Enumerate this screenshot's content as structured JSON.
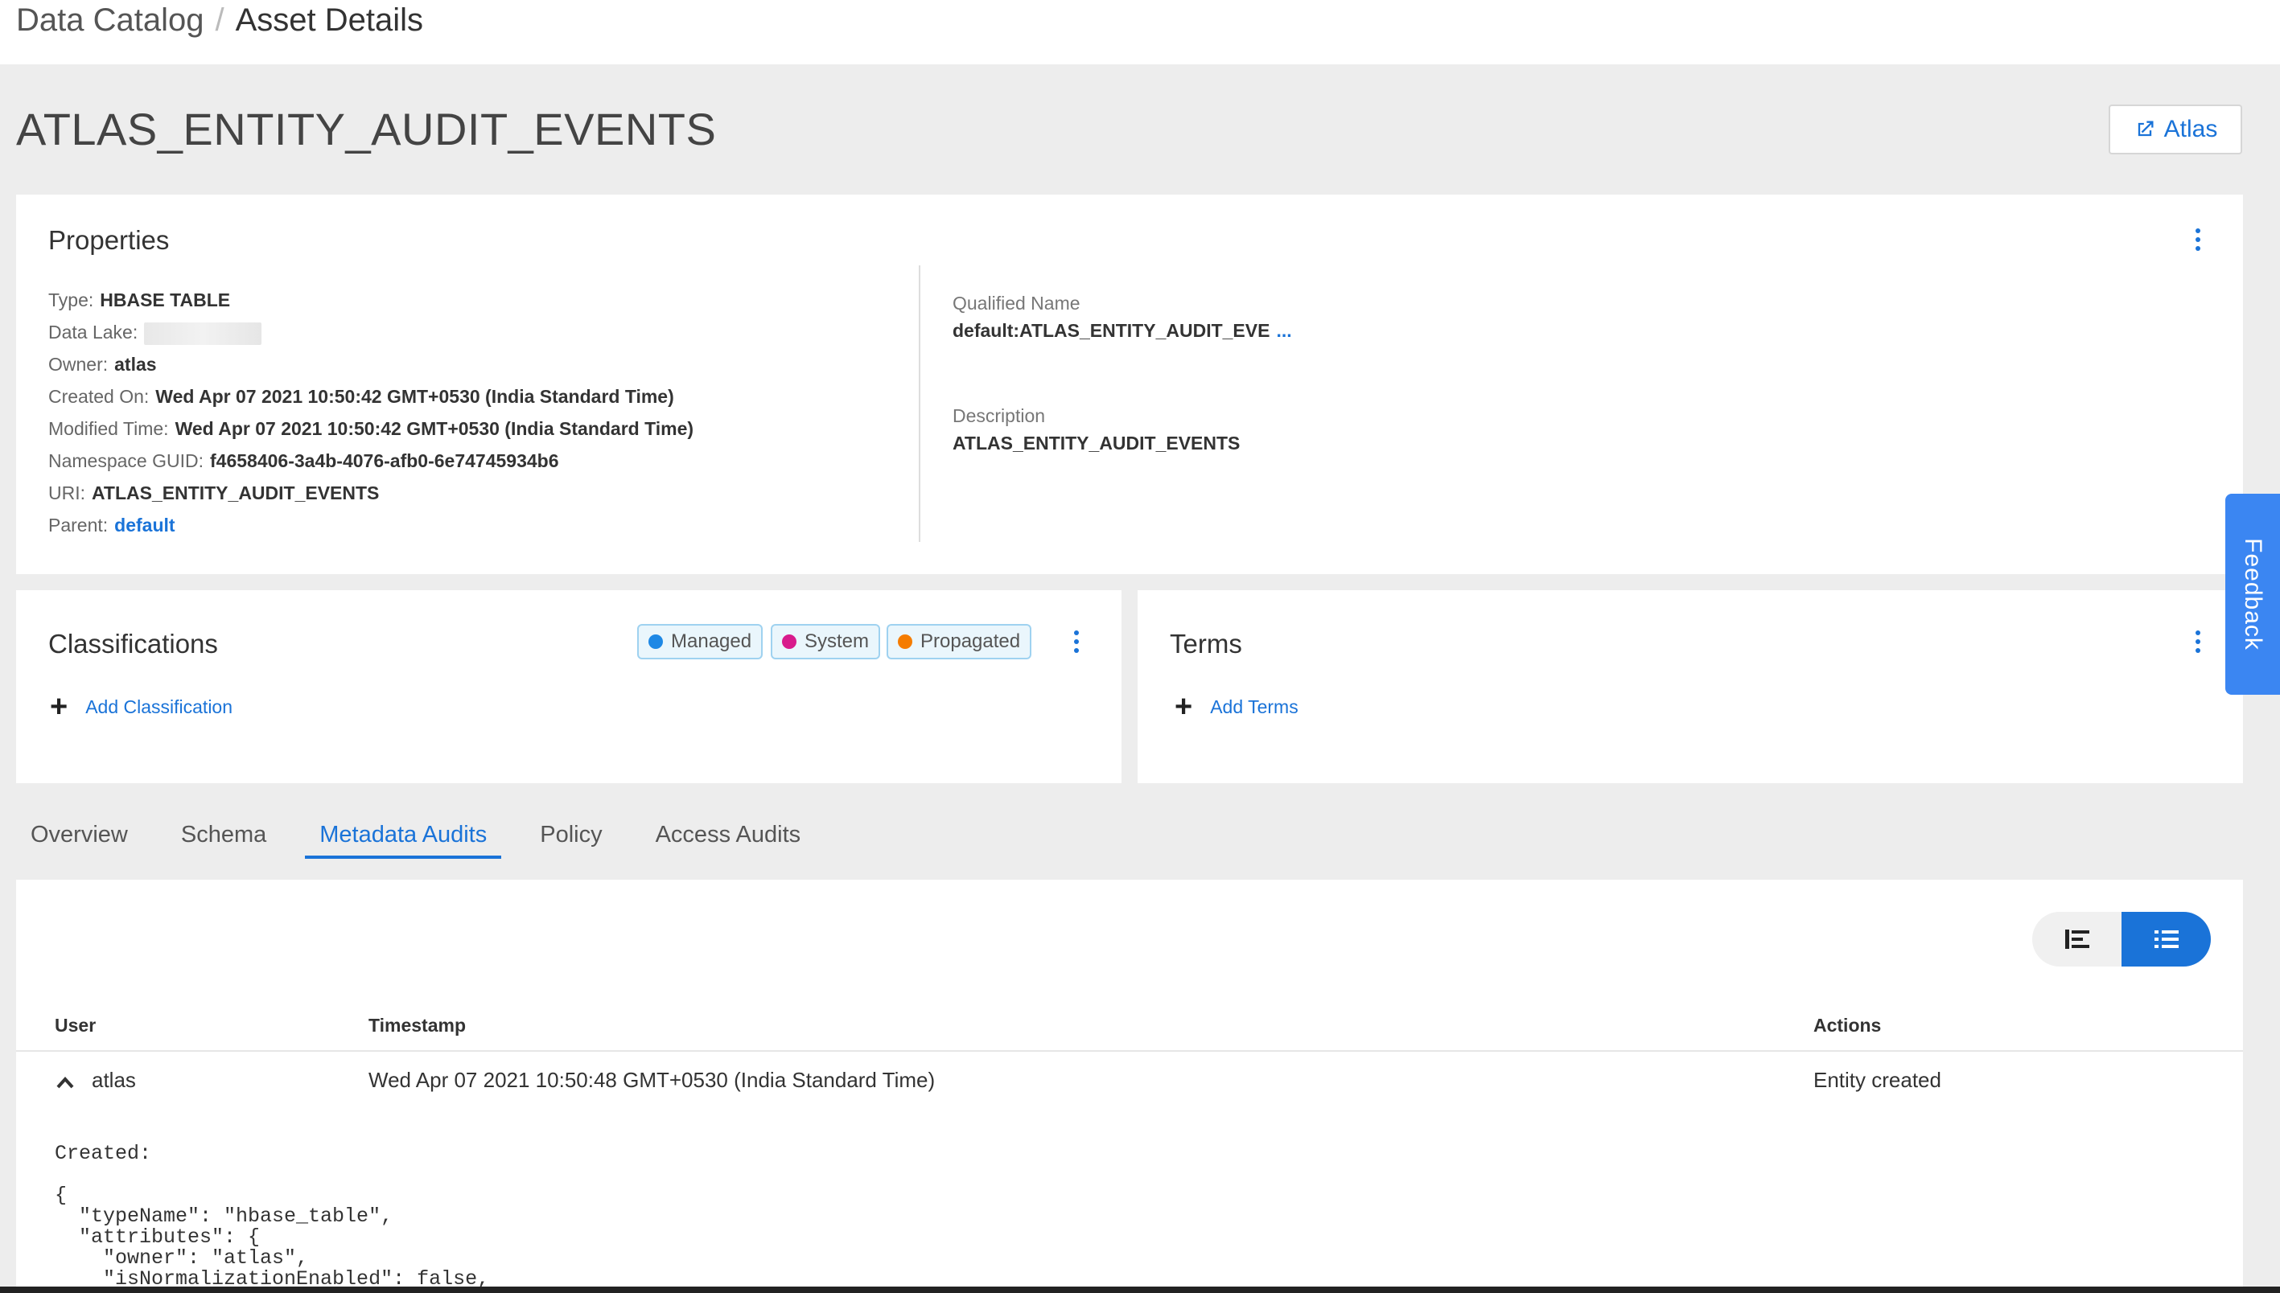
{
  "breadcrumb": {
    "root": "Data Catalog",
    "separator": "/",
    "current": "Asset Details"
  },
  "page_title": "ATLAS_ENTITY_AUDIT_EVENTS",
  "atlas_button": {
    "label": "Atlas",
    "icon": "external-link-icon"
  },
  "properties": {
    "title": "Properties",
    "rows": [
      {
        "label": "Type:",
        "value": "HBASE TABLE"
      },
      {
        "label": "Data Lake:",
        "value": ""
      },
      {
        "label": "Owner:",
        "value": "atlas"
      },
      {
        "label": "Created On:",
        "value": "Wed Apr 07 2021 10:50:42 GMT+0530 (India Standard Time)"
      },
      {
        "label": "Modified Time:",
        "value": "Wed Apr 07 2021 10:50:42 GMT+0530 (India Standard Time)"
      },
      {
        "label": "Namespace GUID:",
        "value": "f4658406-3a4b-4076-afb0-6e74745934b6"
      },
      {
        "label": "URI:",
        "value": "ATLAS_ENTITY_AUDIT_EVENTS"
      },
      {
        "label": "Parent:",
        "value": "default"
      }
    ],
    "qualified_name": {
      "label": "Qualified Name",
      "value": "default:ATLAS_ENTITY_AUDIT_EVE",
      "more": "..."
    },
    "description": {
      "label": "Description",
      "value": "ATLAS_ENTITY_AUDIT_EVENTS"
    }
  },
  "classifications": {
    "title": "Classifications",
    "legend": [
      {
        "label": "Managed",
        "color": "#1e88e5"
      },
      {
        "label": "System",
        "color": "#d81b8c"
      },
      {
        "label": "Propagated",
        "color": "#f57c00"
      }
    ],
    "add_label": "Add Classification"
  },
  "terms": {
    "title": "Terms",
    "add_label": "Add Terms"
  },
  "feedback": {
    "label": "Feedback"
  },
  "tabs": [
    {
      "label": "Overview",
      "active": false
    },
    {
      "label": "Schema",
      "active": false
    },
    {
      "label": "Metadata Audits",
      "active": true
    },
    {
      "label": "Policy",
      "active": false
    },
    {
      "label": "Access Audits",
      "active": false
    }
  ],
  "audit_table": {
    "columns": {
      "user": "User",
      "timestamp": "Timestamp",
      "actions": "Actions"
    },
    "rows": [
      {
        "user": "atlas",
        "timestamp": "Wed Apr 07 2021 10:50:48 GMT+0530 (India Standard Time)",
        "action": "Entity created"
      }
    ],
    "detail_label": "Created:",
    "detail_json": "{\n  \"typeName\": \"hbase_table\",\n  \"attributes\": {\n    \"owner\": \"atlas\",\n    \"isNormalizationEnabled\": false,"
  },
  "colors": {
    "accent": "#1a73d8",
    "feedback": "#3b86f2"
  }
}
